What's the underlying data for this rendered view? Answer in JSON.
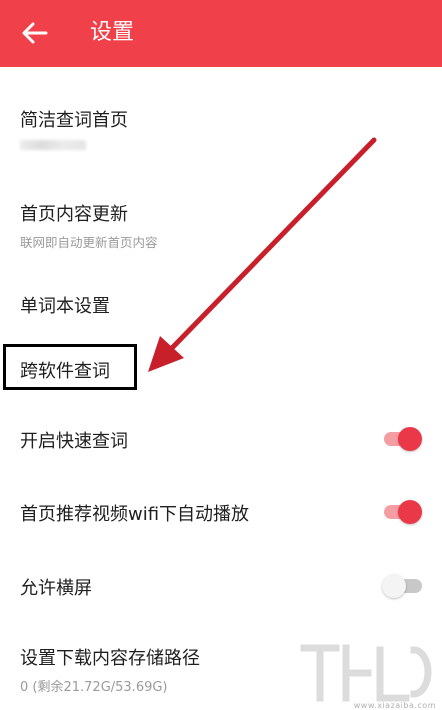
{
  "header": {
    "title": "设置",
    "back_icon": "arrow-left-icon",
    "background": "#f0404a"
  },
  "settings": [
    {
      "title": "简洁查词首页"
    },
    {
      "title": "首页内容更新",
      "subtitle": "联网即自动更新首页内容"
    },
    {
      "title": "单词本设置"
    },
    {
      "title": "跨软件查词"
    },
    {
      "title": "开启快速查词",
      "toggle": "on"
    },
    {
      "title": "首页推荐视频wifi下自动播放",
      "toggle": "on"
    },
    {
      "title": "允许横屏",
      "toggle": "off"
    },
    {
      "title": "设置下载内容存储路径",
      "subtitle": "0 (剩余21.72G/53.69G)"
    }
  ],
  "annotation": {
    "arrow_color": "#c8202a",
    "box_color": "#000000"
  },
  "watermark": {
    "url": "www.xiazaiba.com"
  },
  "accent_color": "#ea3848"
}
